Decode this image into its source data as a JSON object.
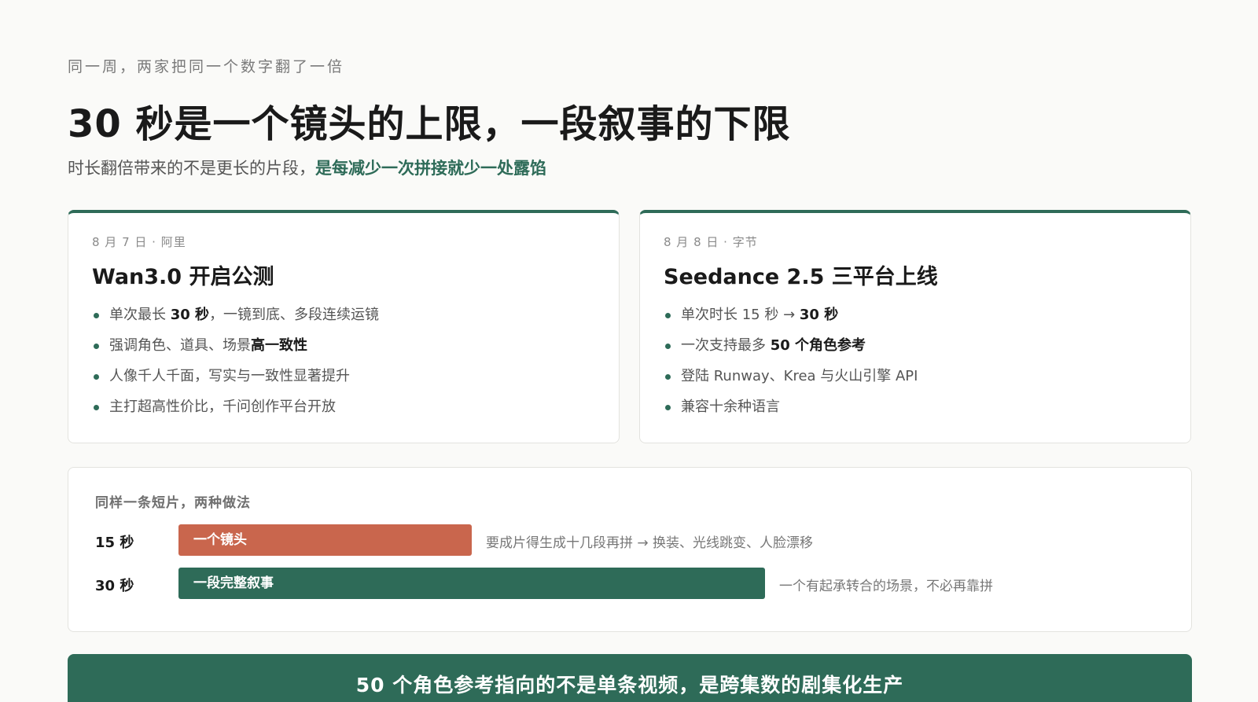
{
  "header": {
    "eyebrow": "同一周，两家把同一个数字翻了一倍",
    "title": "30 秒是一个镜头的上限，一段叙事的下限",
    "subtitle_plain": "时长翻倍带来的不是更长的片段，",
    "subtitle_highlight": "是每减少一次拼接就少一处露馅"
  },
  "cards": [
    {
      "meta": "8 月 7 日 · 阿里",
      "title": "Wan3.0 开启公测",
      "items": [
        {
          "pre": "单次最长 ",
          "bold": "30 秒",
          "post": "，一镜到底、多段连续运镜"
        },
        {
          "pre": "强调角色、道具、场景",
          "bold": "高一致性",
          "post": ""
        },
        {
          "pre": "人像千人千面，写实与一致性显著提升",
          "bold": "",
          "post": ""
        },
        {
          "pre": "主打超高性价比，千问创作平台开放",
          "bold": "",
          "post": ""
        }
      ]
    },
    {
      "meta": "8 月 8 日 · 字节",
      "title": "Seedance 2.5 三平台上线",
      "items": [
        {
          "pre": "单次时长 15 秒 → ",
          "bold": "30 秒",
          "post": ""
        },
        {
          "pre": "一次支持最多 ",
          "bold": "50 个角色参考",
          "post": ""
        },
        {
          "pre": "登陆 Runway、Krea 与火山引擎 API",
          "bold": "",
          "post": ""
        },
        {
          "pre": "兼容十余种语言",
          "bold": "",
          "post": ""
        }
      ]
    }
  ],
  "compare": {
    "label": "同样一条短片，两种做法",
    "rows": [
      {
        "duration": "15 秒",
        "bar_text": "一个镜头",
        "note": "要成片得生成十几段再拼 → 换装、光线跳变、人脸漂移",
        "seconds": 15
      },
      {
        "duration": "30 秒",
        "bar_text": "一段完整叙事",
        "note": "一个有起承转合的场景，不必再靠拼",
        "seconds": 30
      }
    ]
  },
  "banner": {
    "text": "50 个角色参考指向的不是单条视频，是跨集数的剧集化生产"
  },
  "colors": {
    "accent_green": "#2e6b58",
    "accent_orange": "#c9664d"
  }
}
